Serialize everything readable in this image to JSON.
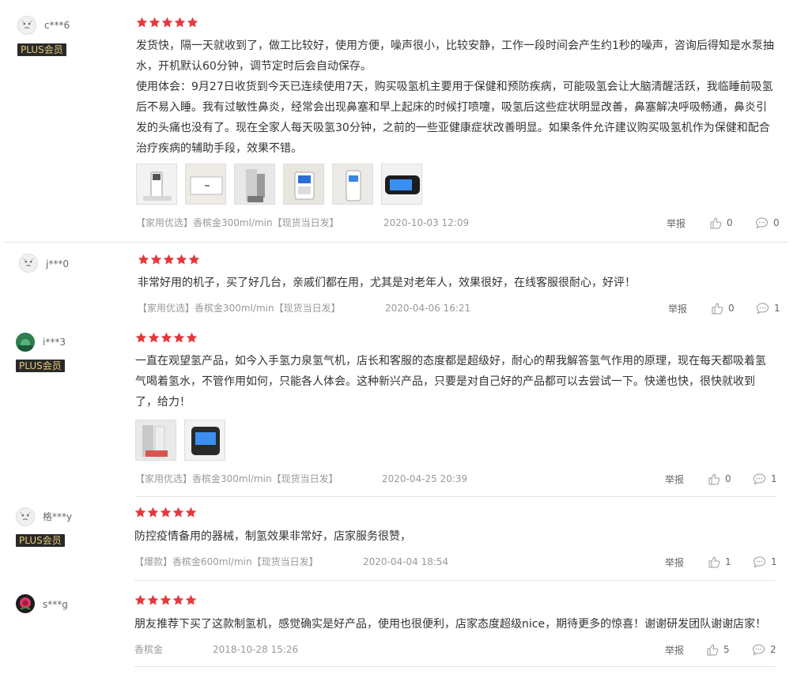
{
  "colors": {
    "star": "#e4393c",
    "plus_bg": "#2a2a2a",
    "plus_text": "#e8c979",
    "meta": "#999999"
  },
  "icons": {
    "star": "star-icon",
    "like": "thumbs-up-icon",
    "comment": "comment-bubble-icon",
    "avatar": "avatar-icon"
  },
  "reviews": [
    {
      "user": "c***6",
      "plus": "PLUS会员",
      "rating": 5,
      "text": [
        "发货快，隔一天就收到了，做工比较好，使用方便，噪声很小，比较安静，工作一段时间会产生约1秒的噪声，咨询后得知是水泵抽水，开机默认60分钟，调节定时后会自动保存。",
        "使用体会：9月27日收货到今天已连续使用7天，购买吸氢机主要用于保健和预防疾病，可能吸氢会让大脑清醒活跃，我临睡前吸氢后不易入睡。我有过敏性鼻炎，经常会出现鼻塞和早上起床的时候打喷嚏，吸氢后这些症状明显改善，鼻塞解决呼吸畅通，鼻炎引发的头痛也没有了。现在全家人每天吸氢30分钟，之前的一些亚健康症状改善明显。如果条件允许建议购买吸氢机作为保健和配合治疗疾病的辅助手段，效果不错。"
      ],
      "meta": "【家用优选】香槟金300ml/min【现货当日发】",
      "date": "2020-10-03 12:09",
      "report": "举报",
      "likes": "0",
      "comments": "0"
    },
    {
      "user": "j***0",
      "rating": 5,
      "text": [
        "非常好用的机子，买了好几台，亲戚们都在用，尤其是对老年人，效果很好，在线客服很耐心，好评！"
      ],
      "meta": "【家用优选】香槟金300ml/min【现货当日发】",
      "date": "2020-04-06 16:21",
      "report": "举报",
      "likes": "0",
      "comments": "1"
    },
    {
      "user": "i***3",
      "plus": "PLUS会员",
      "rating": 5,
      "text": [
        "一直在观望氢产品，如今入手氢力泉氢气机，店长和客服的态度都是超级好，耐心的帮我解答氢气作用的原理，现在每天都吸着氢气喝着氢水，不管作用如何，只能各人体会。这种新兴产品，只要是对自己好的产品都可以去尝试一下。快递也快，很快就收到了，给力！"
      ],
      "meta": "【家用优选】香槟金300ml/min【现货当日发】",
      "date": "2020-04-25 20:39",
      "report": "举报",
      "likes": "0",
      "comments": "1"
    },
    {
      "user": "格***y",
      "plus": "PLUS会员",
      "rating": 5,
      "text": [
        "防控疫情备用的器械，制氢效果非常好，店家服务很赞，"
      ],
      "meta": "【爆款】香槟金600ml/min【现货当日发】",
      "date": "2020-04-04 18:54",
      "report": "举报",
      "likes": "1",
      "comments": "1"
    },
    {
      "user": "s***g",
      "rating": 5,
      "text": [
        "朋友推荐下买了这款制氢机，感觉确实是好产品，使用也很便利，店家态度超级nice，期待更多的惊喜！谢谢研发团队谢谢店家！"
      ],
      "meta": "香槟金",
      "date": "2018-10-28 15:26",
      "report": "举报",
      "likes": "5",
      "comments": "2"
    }
  ]
}
